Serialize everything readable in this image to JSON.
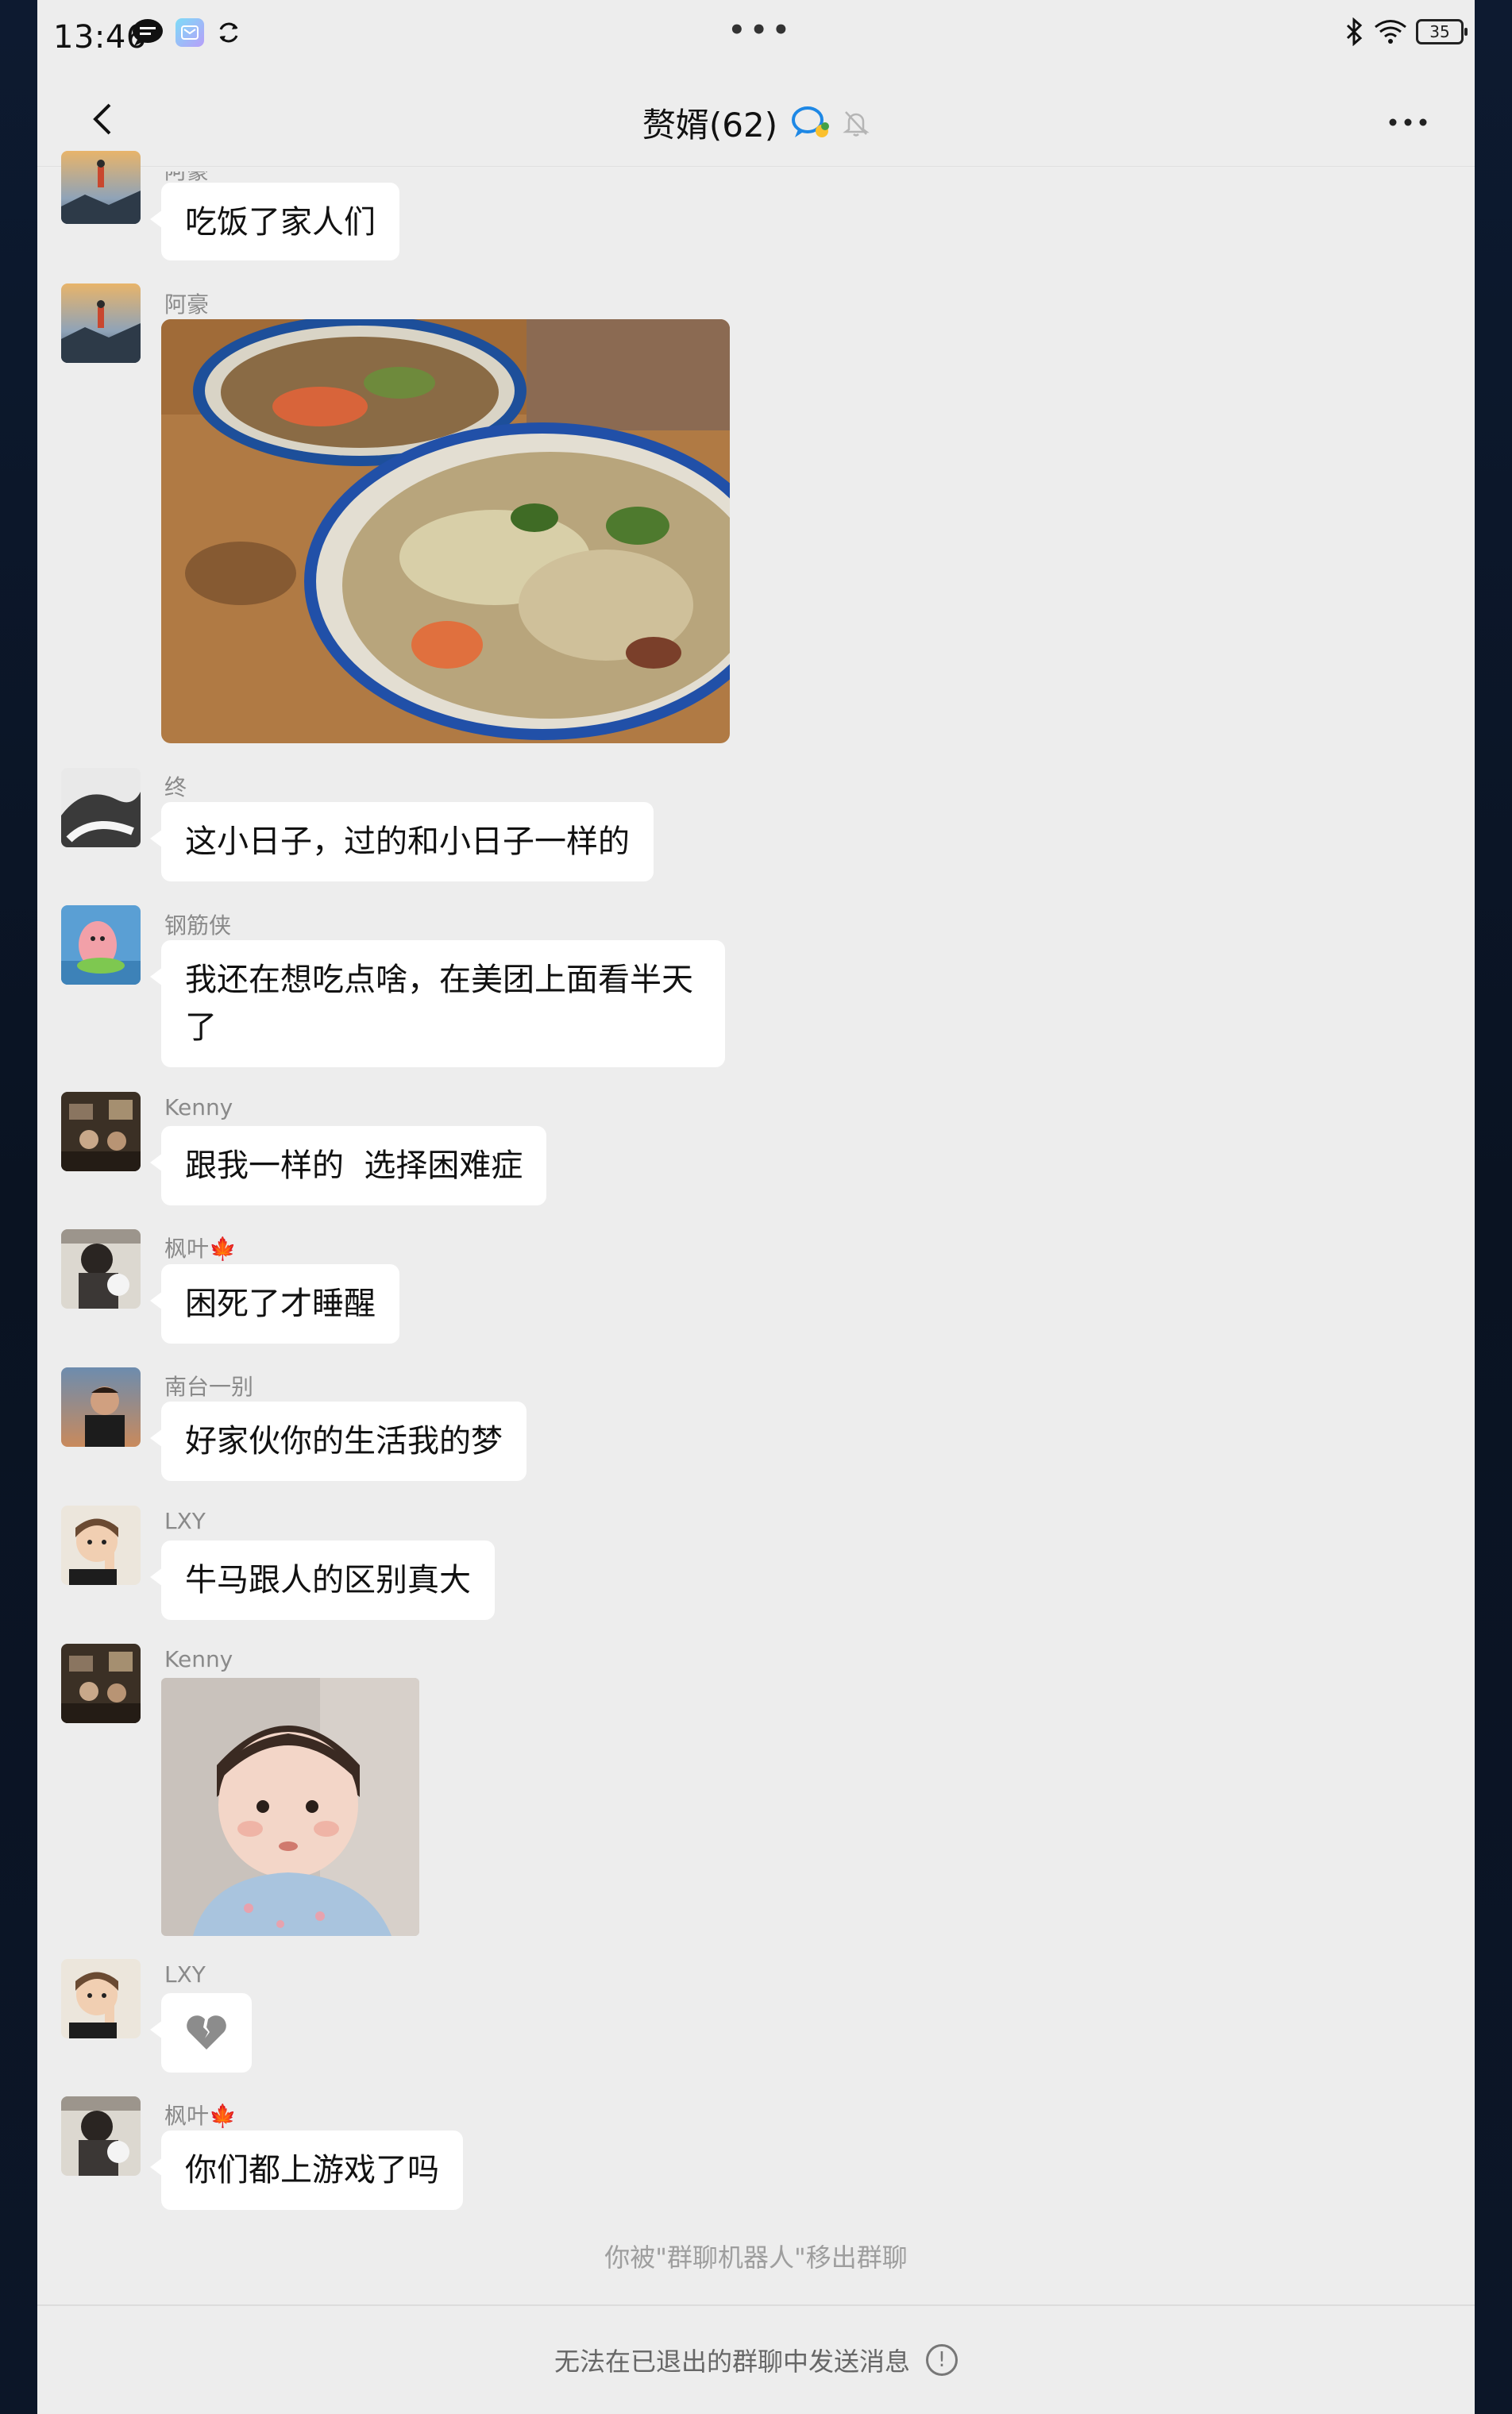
{
  "status_bar": {
    "time": "13:46",
    "battery": "35"
  },
  "nav": {
    "title": "赘婿(62)"
  },
  "messages": [
    {
      "sender": "阿豪",
      "text": "吃饭了家人们"
    },
    {
      "sender": "阿豪",
      "image": "food-photo"
    },
    {
      "sender": "终",
      "text": "这小日子，过的和小日子一样的"
    },
    {
      "sender": "钢筋侠",
      "text_line1": "我还在想吃点啥，在美团上面看半天",
      "text_line2": "了"
    },
    {
      "sender": "Kenny",
      "text": "跟我一样的  选择困难症"
    },
    {
      "sender": "枫叶🍁",
      "text": "困死了才睡醒"
    },
    {
      "sender": "南台一别",
      "text": "好家伙你的生活我的梦"
    },
    {
      "sender": "LXY",
      "text": "牛马跟人的区别真大"
    },
    {
      "sender": "Kenny",
      "image": "baby-sticker"
    },
    {
      "sender": "LXY",
      "text": "💔"
    },
    {
      "sender": "枫叶🍁",
      "text": "你们都上游戏了吗"
    }
  ],
  "system_note": "你被\"群聊机器人\"移出群聊",
  "footer": {
    "text": "无法在已退出的群聊中发送消息",
    "icon": "!"
  },
  "colors": {
    "background": "#ededed",
    "bubble": "#ffffff",
    "accent_blue": "#1e88e5"
  }
}
